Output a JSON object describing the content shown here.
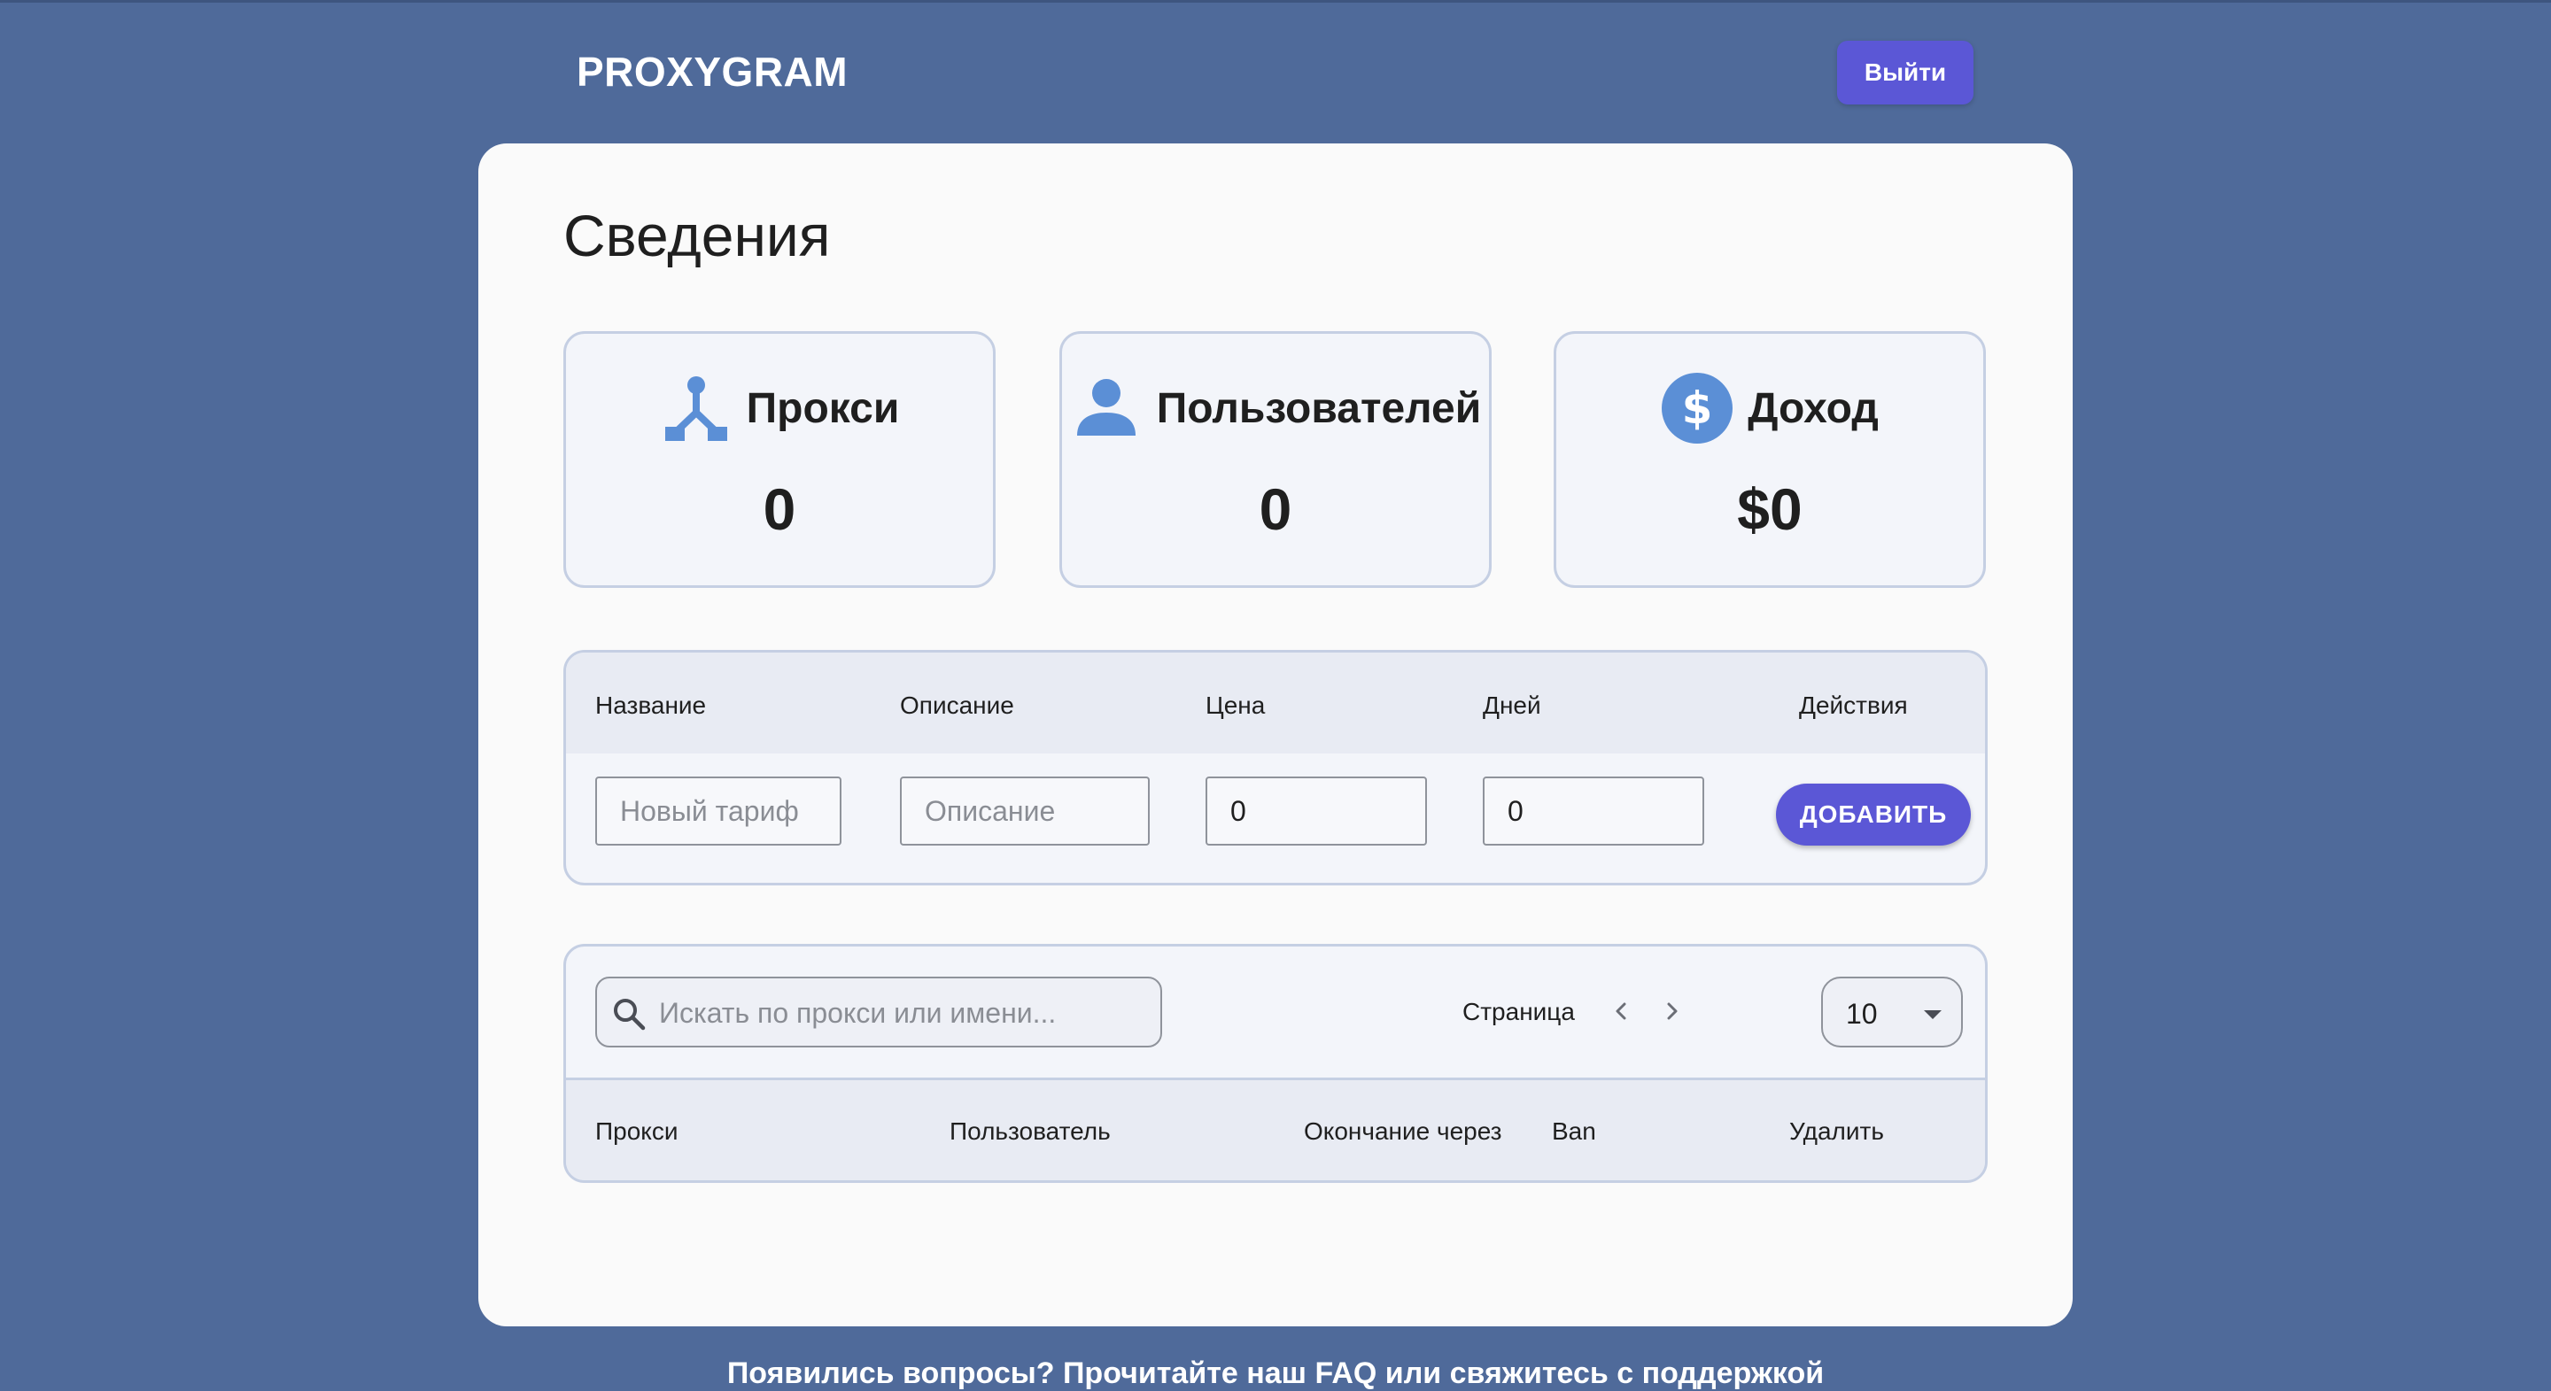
{
  "header": {
    "brand": "PROXYGRAM",
    "logout_label": "Выйти"
  },
  "main": {
    "title": "Сведения",
    "stats": [
      {
        "label": "Прокси",
        "value": "0",
        "icon": "proxy-hub-icon"
      },
      {
        "label": "Пользователей",
        "value": "0",
        "icon": "user-icon"
      },
      {
        "label": "Доход",
        "value": "$0",
        "icon": "dollar-icon"
      }
    ]
  },
  "tariff_form": {
    "columns": [
      "Название",
      "Описание",
      "Цена",
      "Дней",
      "Действия"
    ],
    "name_placeholder": "Новый тариф",
    "description_placeholder": "Описание",
    "price_value": "0",
    "days_value": "0",
    "add_label": "ДОБАВИТЬ"
  },
  "proxy_table": {
    "search_placeholder": "Искать по прокси или имени...",
    "page_label": "Страница",
    "page_size": "10",
    "columns": [
      "Прокси",
      "Пользователь",
      "Окончание через",
      "Ban",
      "Удалить"
    ]
  },
  "footer": {
    "text": "Появились вопросы? Прочитайте наш FAQ или свяжитесь с поддержкой"
  },
  "colors": {
    "background": "#4f6a9a",
    "accent": "#5b57d6",
    "icon": "#5b8fd6"
  }
}
